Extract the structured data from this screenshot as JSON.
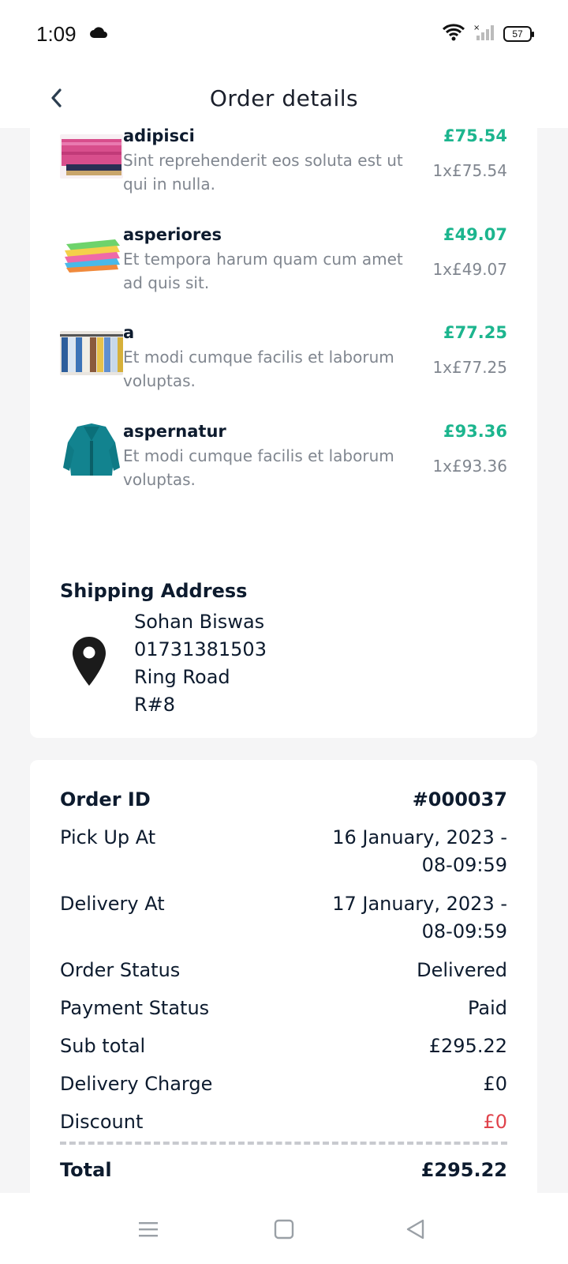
{
  "status_bar": {
    "time": "1:09",
    "battery": "57",
    "icons": [
      "cloud-icon",
      "wifi-icon",
      "signal-icon",
      "battery-icon"
    ]
  },
  "header": {
    "title": "Order details",
    "back_icon": "chevron-left-icon"
  },
  "items": [
    {
      "name": "adipisci",
      "description": "Sint reprehenderit eos soluta est ut qui in nulla.",
      "price": "£75.54",
      "quantity": "1x£75.54",
      "thumb": "pink-fabric"
    },
    {
      "name": "asperiores",
      "description": "Et tempora harum quam cum amet ad quis sit.",
      "price": "£49.07",
      "quantity": "1x£49.07",
      "thumb": "folded-towels"
    },
    {
      "name": "a",
      "description": "Et modi cumque facilis et laborum voluptas.",
      "price": "£77.25",
      "quantity": "1x£77.25",
      "thumb": "clothes-rack"
    },
    {
      "name": "aspernatur",
      "description": "Et modi cumque facilis et laborum voluptas.",
      "price": "£93.36",
      "quantity": "1x£93.36",
      "thumb": "teal-coat"
    }
  ],
  "shipping": {
    "heading": "Shipping Address",
    "name": "Sohan Biswas",
    "phone": "01731381503",
    "street": "Ring Road",
    "house": "R#8"
  },
  "summary": {
    "order_id_label": "Order ID",
    "order_id": "#000037",
    "pickup_label": "Pick Up At",
    "pickup_date": "16 January, 2023 -",
    "pickup_time": "08-09:59",
    "delivery_label": "Delivery At",
    "delivery_date": "17 January, 2023 -",
    "delivery_time": "08-09:59",
    "order_status_label": "Order Status",
    "order_status": "Delivered",
    "payment_status_label": "Payment Status",
    "payment_status": "Paid",
    "subtotal_label": "Sub total",
    "subtotal": "£295.22",
    "delivery_charge_label": "Delivery Charge",
    "delivery_charge": "£0",
    "discount_label": "Discount",
    "discount": "£0",
    "total_label": "Total",
    "total": "£295.22"
  },
  "colors": {
    "price_green": "#1cb58e",
    "discount_red": "#e0434b",
    "text_dark": "#0d1b2e",
    "text_muted": "#80868f",
    "background": "#f5f5f6"
  }
}
